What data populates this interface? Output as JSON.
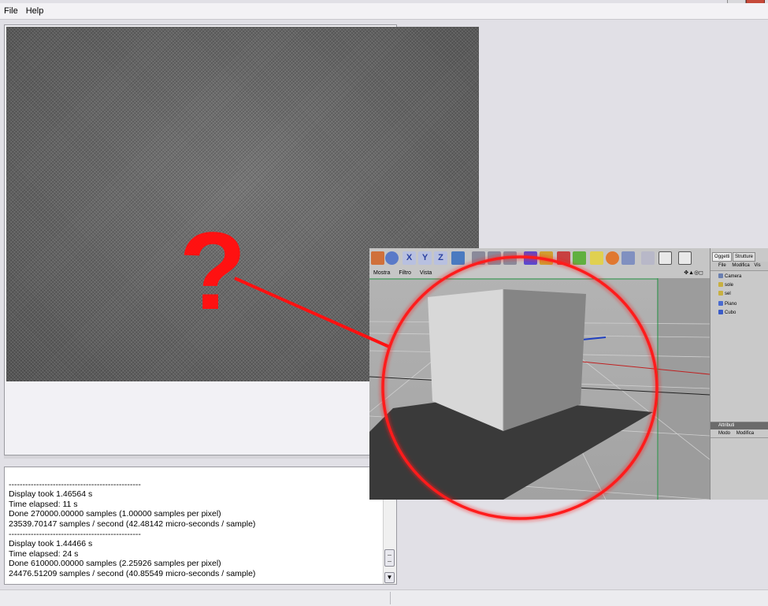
{
  "menubar": {
    "items": [
      "File",
      "Help"
    ]
  },
  "console": {
    "lines": [
      "------------------------------------------------",
      "Display took 1.46564 s",
      "Time elapsed: 11 s",
      "Done 270000.00000 samples (1.00000 samples per pixel)",
      "23539.70147 samples / second (42.48142 micro-seconds / sample)",
      "------------------------------------------------",
      "Display took 1.44466 s",
      "Time elapsed: 24 s",
      "Done 610000.00000 samples (2.25926 samples per pixel)",
      "24476.51209 samples / second (40.85549 micro-seconds / sample)"
    ]
  },
  "annotation": {
    "mark": "?",
    "color": "#ff1111"
  },
  "inset": {
    "axis_labels": [
      "X",
      "Y",
      "Z"
    ],
    "viewport_menu": [
      "Mostra",
      "Filtro",
      "Vista"
    ],
    "panel_tabs": [
      "Oggetti",
      "Strutture"
    ],
    "panel_menu": [
      "File",
      "Modifica",
      "Vis"
    ],
    "objects": [
      {
        "name": "Camera",
        "color": "#6a7fb0"
      },
      {
        "name": "sole",
        "color": "#c8b040"
      },
      {
        "name": "sel",
        "color": "#c8b040"
      },
      {
        "name": "Piano",
        "color": "#4a6bd0"
      },
      {
        "name": "Cubo",
        "color": "#3a5bc8"
      }
    ],
    "attr_header": "Attributi",
    "attr_menu": [
      "Modo",
      "Modifica"
    ]
  }
}
